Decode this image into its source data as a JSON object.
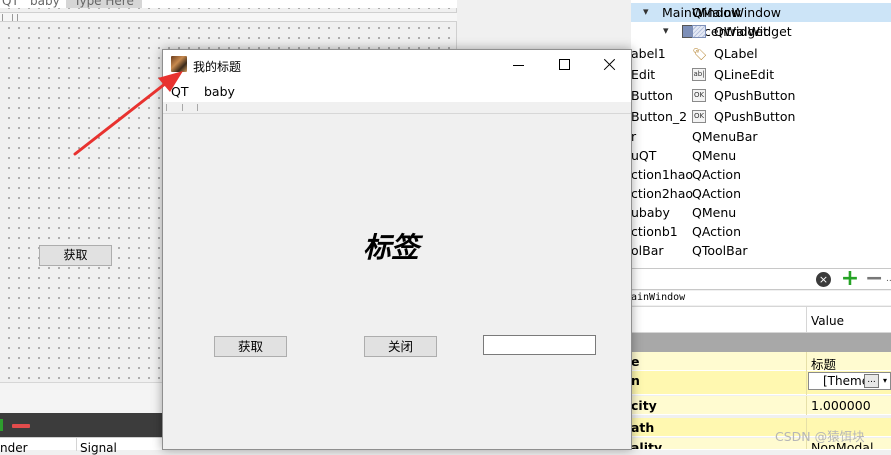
{
  "designer": {
    "menubar": [
      "QT",
      "baby",
      "Type Here"
    ],
    "get_button_label": "获取",
    "signal_columns": [
      "nder",
      "Signal"
    ]
  },
  "object_inspector": {
    "rows": [
      {
        "name": "MainWindow",
        "class": "QMainWindow"
      },
      {
        "name": "centralWidget",
        "class": "QWidget"
      },
      {
        "name": "abel1",
        "class": "QLabel"
      },
      {
        "name": "Edit",
        "class": "QLineEdit"
      },
      {
        "name": "Button",
        "class": "QPushButton"
      },
      {
        "name": "Button_2",
        "class": "QPushButton"
      },
      {
        "name": "r",
        "class": "QMenuBar"
      },
      {
        "name": "uQT",
        "class": "QMenu"
      },
      {
        "name": "ction1hao",
        "class": "QAction"
      },
      {
        "name": "ction2hao",
        "class": "QAction"
      },
      {
        "name": "ubaby",
        "class": "QMenu"
      },
      {
        "name": "ctionb1",
        "class": "QAction"
      },
      {
        "name": "olBar",
        "class": "QToolBar"
      }
    ],
    "widget_icon_text": "OK"
  },
  "property_editor": {
    "class_label": "ainWindow",
    "value_header": "Value",
    "rows": [
      {
        "name": "e",
        "value": "标题"
      },
      {
        "name": "n",
        "value": "[Theme"
      },
      {
        "name": "city",
        "value": "1.000000"
      },
      {
        "name": "ath",
        "value": ""
      },
      {
        "name": "ality",
        "value": "NonModal"
      }
    ],
    "theme_more": "...",
    "theme_arrow": "▾"
  },
  "filter": {
    "clear_icon": "×",
    "add_icon": "+",
    "remove_icon": "−",
    "more_icon": "..."
  },
  "app_window": {
    "title": "我的标题",
    "menu": [
      "QT",
      "baby"
    ],
    "label_text": "标签",
    "buttons": {
      "get": "获取",
      "close": "关闭"
    },
    "line_edit_value": ""
  },
  "watermark": "CSDN @猿饵块"
}
